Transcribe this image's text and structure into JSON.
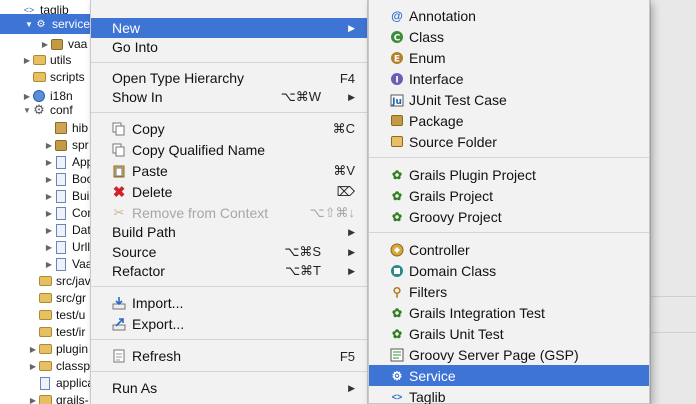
{
  "tree": {
    "items": [
      {
        "label": "taglib",
        "icon": "package-icon"
      },
      {
        "label": "service",
        "icon": "package-icon"
      },
      {
        "label": "vaa",
        "icon": "package-icon"
      },
      {
        "label": "utils",
        "icon": "folder-icon"
      },
      {
        "label": "scripts",
        "icon": "folder-icon"
      },
      {
        "label": "i18n",
        "icon": "globe-icon"
      },
      {
        "label": "conf",
        "icon": "gear-icon"
      },
      {
        "label": "hib",
        "icon": "database-icon"
      },
      {
        "label": "spr",
        "icon": "package-icon"
      },
      {
        "label": "App",
        "icon": "file-icon"
      },
      {
        "label": "Boo",
        "icon": "file-icon"
      },
      {
        "label": "Bui",
        "icon": "file-icon"
      },
      {
        "label": "Con",
        "icon": "file-icon"
      },
      {
        "label": "Dat",
        "icon": "file-icon"
      },
      {
        "label": "Urll",
        "icon": "file-icon"
      },
      {
        "label": "Vaa",
        "icon": "file-icon"
      },
      {
        "label": "src/jav",
        "icon": "folder-icon"
      },
      {
        "label": "src/gr",
        "icon": "folder-icon"
      },
      {
        "label": "test/u",
        "icon": "folder-icon"
      },
      {
        "label": "test/ir",
        "icon": "folder-icon"
      },
      {
        "label": "plugin",
        "icon": "folder-icon"
      },
      {
        "label": "classp",
        "icon": "folder-icon"
      },
      {
        "label": "applica",
        "icon": "file-icon"
      },
      {
        "label": "grails-",
        "icon": "folder-icon"
      }
    ]
  },
  "context_menu": {
    "new": "New",
    "go_into": "Go Into",
    "open_type_hierarchy": "Open Type Hierarchy",
    "open_type_hierarchy_shortcut": "F4",
    "show_in": "Show In",
    "show_in_shortcut": "⌥⌘W",
    "copy": "Copy",
    "copy_shortcut": "⌘C",
    "copy_qualified_name": "Copy Qualified Name",
    "paste": "Paste",
    "paste_shortcut": "⌘V",
    "delete": "Delete",
    "delete_shortcut": "⌦",
    "remove_from_context": "Remove from Context",
    "remove_from_context_shortcut": "⌥⇧⌘↓",
    "build_path": "Build Path",
    "source": "Source",
    "source_shortcut": "⌥⌘S",
    "refactor": "Refactor",
    "refactor_shortcut": "⌥⌘T",
    "import": "Import...",
    "export": "Export...",
    "refresh": "Refresh",
    "refresh_shortcut": "F5",
    "run_as": "Run As"
  },
  "submenu": {
    "annotation": "Annotation",
    "class": "Class",
    "enum": "Enum",
    "interface": "Interface",
    "junit_test_case": "JUnit Test Case",
    "package": "Package",
    "source_folder": "Source Folder",
    "grails_plugin_project": "Grails Plugin Project",
    "grails_project": "Grails Project",
    "groovy_project": "Groovy Project",
    "controller": "Controller",
    "domain_class": "Domain Class",
    "filters": "Filters",
    "grails_integration_test": "Grails Integration Test",
    "grails_unit_test": "Grails Unit Test",
    "groovy_server_page": "Groovy Server Page (GSP)",
    "service": "Service",
    "taglib": "Taglib"
  },
  "colors": {
    "selection": "#3e74d4",
    "menu_bg": "#f2f2f2",
    "disabled_text": "#a7a7a7"
  }
}
